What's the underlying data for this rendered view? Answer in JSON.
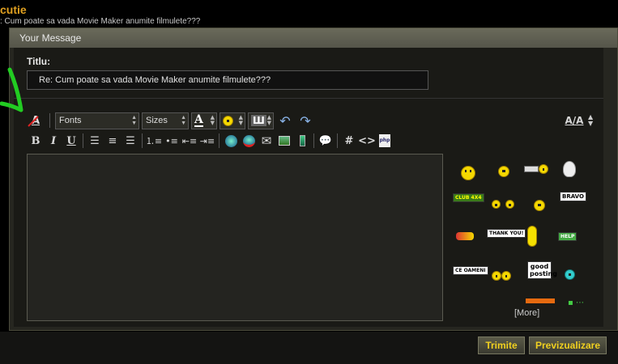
{
  "header": {
    "section_title": "cutie",
    "topic_line": ": Cum poate sa vada Movie Maker anumite filmulete???"
  },
  "form": {
    "box_title": "Your Message",
    "title_label": "Titlu:",
    "title_value": "Re: Cum poate sa vada Movie Maker anumite filmulete???",
    "editor_value": ""
  },
  "toolbar": {
    "remove_format_glyph": "A",
    "fonts_label": "Fonts",
    "sizes_label": "Sizes",
    "bold": "B",
    "italic": "I",
    "underline": "U",
    "code": "#",
    "html": "<>",
    "php": "php"
  },
  "smilies": {
    "bravo": "BRAVO",
    "thank_you": "THANK YOU!",
    "help": "HELP",
    "ce_oameni": "CE OAMENI",
    "good_posting": "good posting",
    "club": "CLUB 4X4",
    "more": "[More]"
  },
  "buttons": {
    "submit": "Trimite",
    "preview": "Previzualizare"
  },
  "colors": {
    "accent_yellow": "#f0d020",
    "panel": "#262620",
    "annotation_arrow": "#22cc22"
  }
}
